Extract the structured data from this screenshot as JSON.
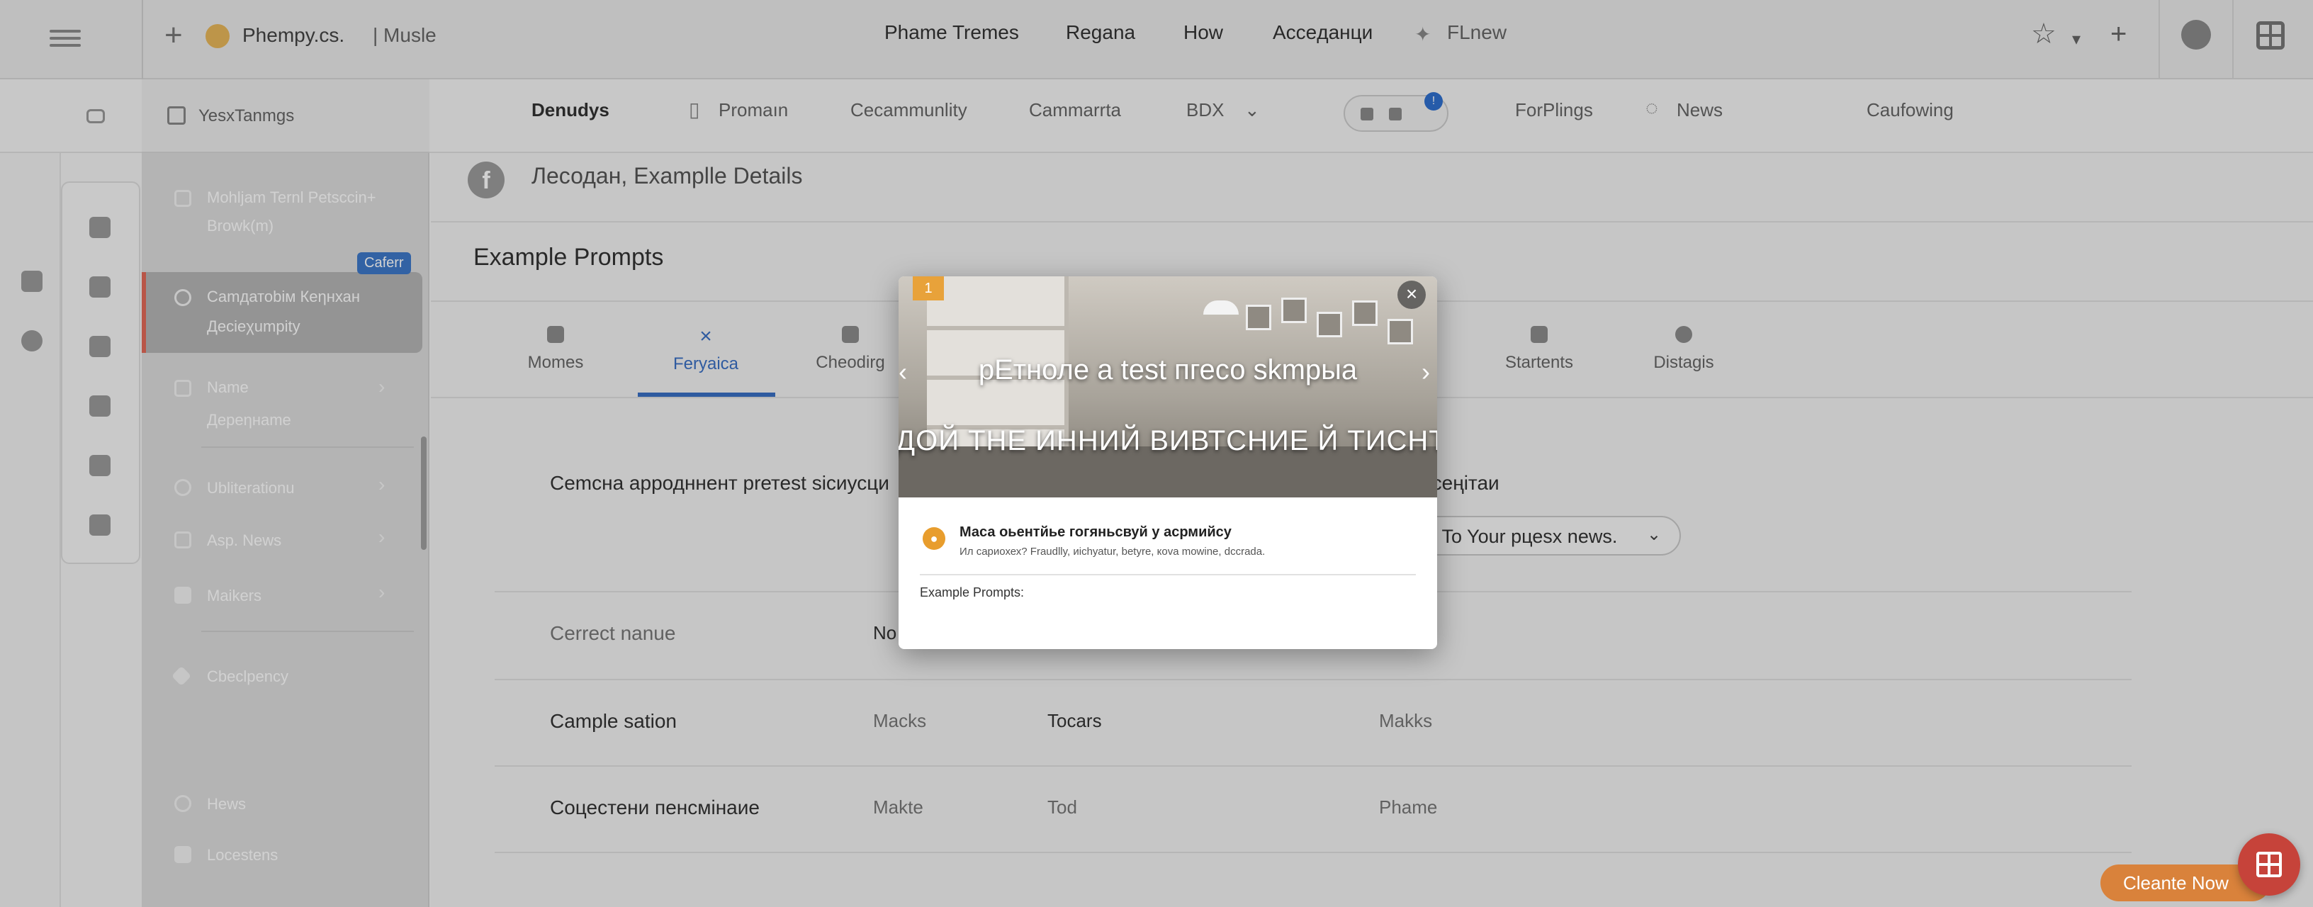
{
  "topbar": {
    "app_title": "Phempy.cs.",
    "app_sub": "| Musle",
    "nav": [
      "Phame Tremes",
      "Regana",
      "How",
      "Acceданци",
      "FLnew"
    ]
  },
  "subbar": {
    "tabs": [
      "Denudys",
      "Promaın",
      "Cecammunlity",
      "Cammarrta",
      "BDX",
      "ForPlings",
      "News",
      "Caufowing"
    ],
    "toggle_badge": "!"
  },
  "sidebar": {
    "header": "YesxTanmgs",
    "items": [
      {
        "line1": "Mohljam Ternl Petsccin+",
        "line2": "Browk(m)"
      },
      {
        "line1": "Camдатоbім Кеηнхан",
        "line2": "Десіеχumpity"
      },
      {
        "line1": "Name",
        "line2": "Дереηнаme"
      },
      {
        "line1": "Ubliterationu"
      },
      {
        "line1": "Asp. News"
      },
      {
        "line1": "Maikers"
      },
      {
        "line1": "Cbeclpency"
      },
      {
        "line1": "Hews"
      },
      {
        "line1": "Locestens"
      }
    ],
    "badge": "Caferr"
  },
  "main": {
    "breadcrumb": "Лесодан, Examplle Details",
    "section_title": "Example Prompts",
    "tabs": [
      "Momes",
      "Feryaica",
      "Cheodirg",
      "Startents",
      "Distagis"
    ],
    "row1_label": "Cemcна appодннент prетеst sicиусци",
    "row1_right": "Aссеңітаи",
    "pill_text": "w, To Your pцеsх news.",
    "row2": {
      "label": "Cerrect nanue",
      "c1": "No"
    },
    "row3": {
      "label": "Cample sation",
      "c1": "Macks",
      "c2": "Tocars",
      "c3": "Makks"
    },
    "row4": {
      "label": "Coцестени пенсмінаие",
      "c1": "Makte",
      "c2": "Tod",
      "c3": "Phame"
    }
  },
  "modal": {
    "num": "1",
    "close": "×",
    "headline": "рЕтноле a test пгесо skmpыa",
    "subheadline": "ДОЙ ТНЕ ИННИЙ ВИВТСНИЕ Й ТИСНТА",
    "info_title": "Маса оьентйье гогяньсвуй у асрмийсу",
    "info_sub": "Ил сариохех? Fraudlly, иісһуаtur, betyre, коvа mowine, dccrada.",
    "example_label": "Example Prompts:"
  },
  "cta_label": "Cleante Now",
  "colors": {
    "accent": "#3a6fc4",
    "selected_border": "#e26a58",
    "cta": "#d9823b",
    "fab": "#c6433a"
  }
}
